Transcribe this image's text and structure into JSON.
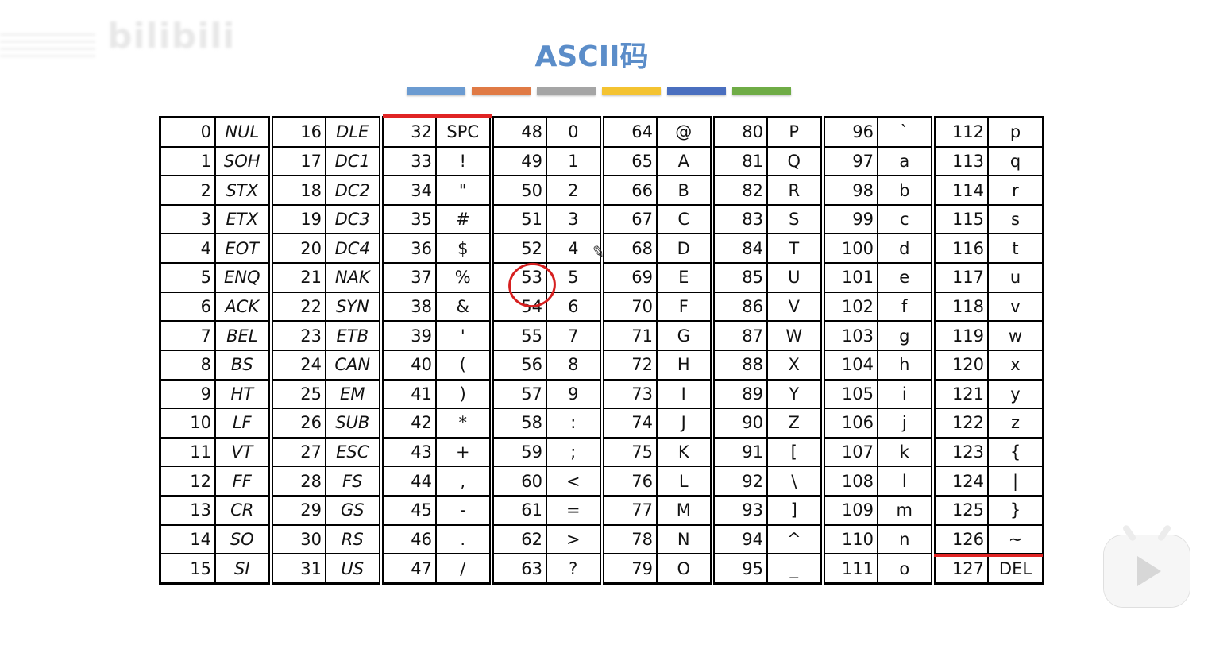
{
  "watermark": "bilibili",
  "title": "ASCII码",
  "accent_bars": [
    "#6b9bd1",
    "#e07a45",
    "#a5a5a5",
    "#f4c331",
    "#4a6fbf",
    "#6fac46"
  ],
  "table": {
    "columns": [
      {
        "control": true,
        "entries": [
          [
            "0",
            "NUL"
          ],
          [
            "1",
            "SOH"
          ],
          [
            "2",
            "STX"
          ],
          [
            "3",
            "ETX"
          ],
          [
            "4",
            "EOT"
          ],
          [
            "5",
            "ENQ"
          ],
          [
            "6",
            "ACK"
          ],
          [
            "7",
            "BEL"
          ],
          [
            "8",
            "BS"
          ],
          [
            "9",
            "HT"
          ],
          [
            "10",
            "LF"
          ],
          [
            "11",
            "VT"
          ],
          [
            "12",
            "FF"
          ],
          [
            "13",
            "CR"
          ],
          [
            "14",
            "SO"
          ],
          [
            "15",
            "SI"
          ]
        ]
      },
      {
        "control": true,
        "entries": [
          [
            "16",
            "DLE"
          ],
          [
            "17",
            "DC1"
          ],
          [
            "18",
            "DC2"
          ],
          [
            "19",
            "DC3"
          ],
          [
            "20",
            "DC4"
          ],
          [
            "21",
            "NAK"
          ],
          [
            "22",
            "SYN"
          ],
          [
            "23",
            "ETB"
          ],
          [
            "24",
            "CAN"
          ],
          [
            "25",
            "EM"
          ],
          [
            "26",
            "SUB"
          ],
          [
            "27",
            "ESC"
          ],
          [
            "28",
            "FS"
          ],
          [
            "29",
            "GS"
          ],
          [
            "30",
            "RS"
          ],
          [
            "31",
            "US"
          ]
        ]
      },
      {
        "control": false,
        "entries": [
          [
            "32",
            "SPC"
          ],
          [
            "33",
            "!"
          ],
          [
            "34",
            "\""
          ],
          [
            "35",
            "#"
          ],
          [
            "36",
            "$"
          ],
          [
            "37",
            "%"
          ],
          [
            "38",
            "&"
          ],
          [
            "39",
            "'"
          ],
          [
            "40",
            "("
          ],
          [
            "41",
            ")"
          ],
          [
            "42",
            "*"
          ],
          [
            "43",
            "+"
          ],
          [
            "44",
            ","
          ],
          [
            "45",
            "-"
          ],
          [
            "46",
            "."
          ],
          [
            "47",
            "/"
          ]
        ]
      },
      {
        "control": false,
        "entries": [
          [
            "48",
            "0"
          ],
          [
            "49",
            "1"
          ],
          [
            "50",
            "2"
          ],
          [
            "51",
            "3"
          ],
          [
            "52",
            "4"
          ],
          [
            "53",
            "5"
          ],
          [
            "54",
            "6"
          ],
          [
            "55",
            "7"
          ],
          [
            "56",
            "8"
          ],
          [
            "57",
            "9"
          ],
          [
            "58",
            ":"
          ],
          [
            "59",
            ";"
          ],
          [
            "60",
            "<"
          ],
          [
            "61",
            "="
          ],
          [
            "62",
            ">"
          ],
          [
            "63",
            "?"
          ]
        ]
      },
      {
        "control": false,
        "entries": [
          [
            "64",
            "@"
          ],
          [
            "65",
            "A"
          ],
          [
            "66",
            "B"
          ],
          [
            "67",
            "C"
          ],
          [
            "68",
            "D"
          ],
          [
            "69",
            "E"
          ],
          [
            "70",
            "F"
          ],
          [
            "71",
            "G"
          ],
          [
            "72",
            "H"
          ],
          [
            "73",
            "I"
          ],
          [
            "74",
            "J"
          ],
          [
            "75",
            "K"
          ],
          [
            "76",
            "L"
          ],
          [
            "77",
            "M"
          ],
          [
            "78",
            "N"
          ],
          [
            "79",
            "O"
          ]
        ]
      },
      {
        "control": false,
        "entries": [
          [
            "80",
            "P"
          ],
          [
            "81",
            "Q"
          ],
          [
            "82",
            "R"
          ],
          [
            "83",
            "S"
          ],
          [
            "84",
            "T"
          ],
          [
            "85",
            "U"
          ],
          [
            "86",
            "V"
          ],
          [
            "87",
            "W"
          ],
          [
            "88",
            "X"
          ],
          [
            "89",
            "Y"
          ],
          [
            "90",
            "Z"
          ],
          [
            "91",
            "["
          ],
          [
            "92",
            "\\"
          ],
          [
            "93",
            "]"
          ],
          [
            "94",
            "^"
          ],
          [
            "95",
            "_"
          ]
        ]
      },
      {
        "control": false,
        "entries": [
          [
            "96",
            "`"
          ],
          [
            "97",
            "a"
          ],
          [
            "98",
            "b"
          ],
          [
            "99",
            "c"
          ],
          [
            "100",
            "d"
          ],
          [
            "101",
            "e"
          ],
          [
            "102",
            "f"
          ],
          [
            "103",
            "g"
          ],
          [
            "104",
            "h"
          ],
          [
            "105",
            "i"
          ],
          [
            "106",
            "j"
          ],
          [
            "107",
            "k"
          ],
          [
            "108",
            "l"
          ],
          [
            "109",
            "m"
          ],
          [
            "110",
            "n"
          ],
          [
            "111",
            "o"
          ]
        ]
      },
      {
        "control": false,
        "entries": [
          [
            "112",
            "p"
          ],
          [
            "113",
            "q"
          ],
          [
            "114",
            "r"
          ],
          [
            "115",
            "s"
          ],
          [
            "116",
            "t"
          ],
          [
            "117",
            "u"
          ],
          [
            "118",
            "v"
          ],
          [
            "119",
            "w"
          ],
          [
            "120",
            "x"
          ],
          [
            "121",
            "y"
          ],
          [
            "122",
            "z"
          ],
          [
            "123",
            "{"
          ],
          [
            "124",
            "|"
          ],
          [
            "125",
            "}"
          ],
          [
            "126",
            "~"
          ],
          [
            "127",
            "DEL"
          ]
        ]
      }
    ]
  },
  "annotations": {
    "highlight_color": "#e02424",
    "circled_value": "53"
  },
  "icons": {
    "pencil": "pencil-cursor-icon",
    "player": "play-icon"
  }
}
